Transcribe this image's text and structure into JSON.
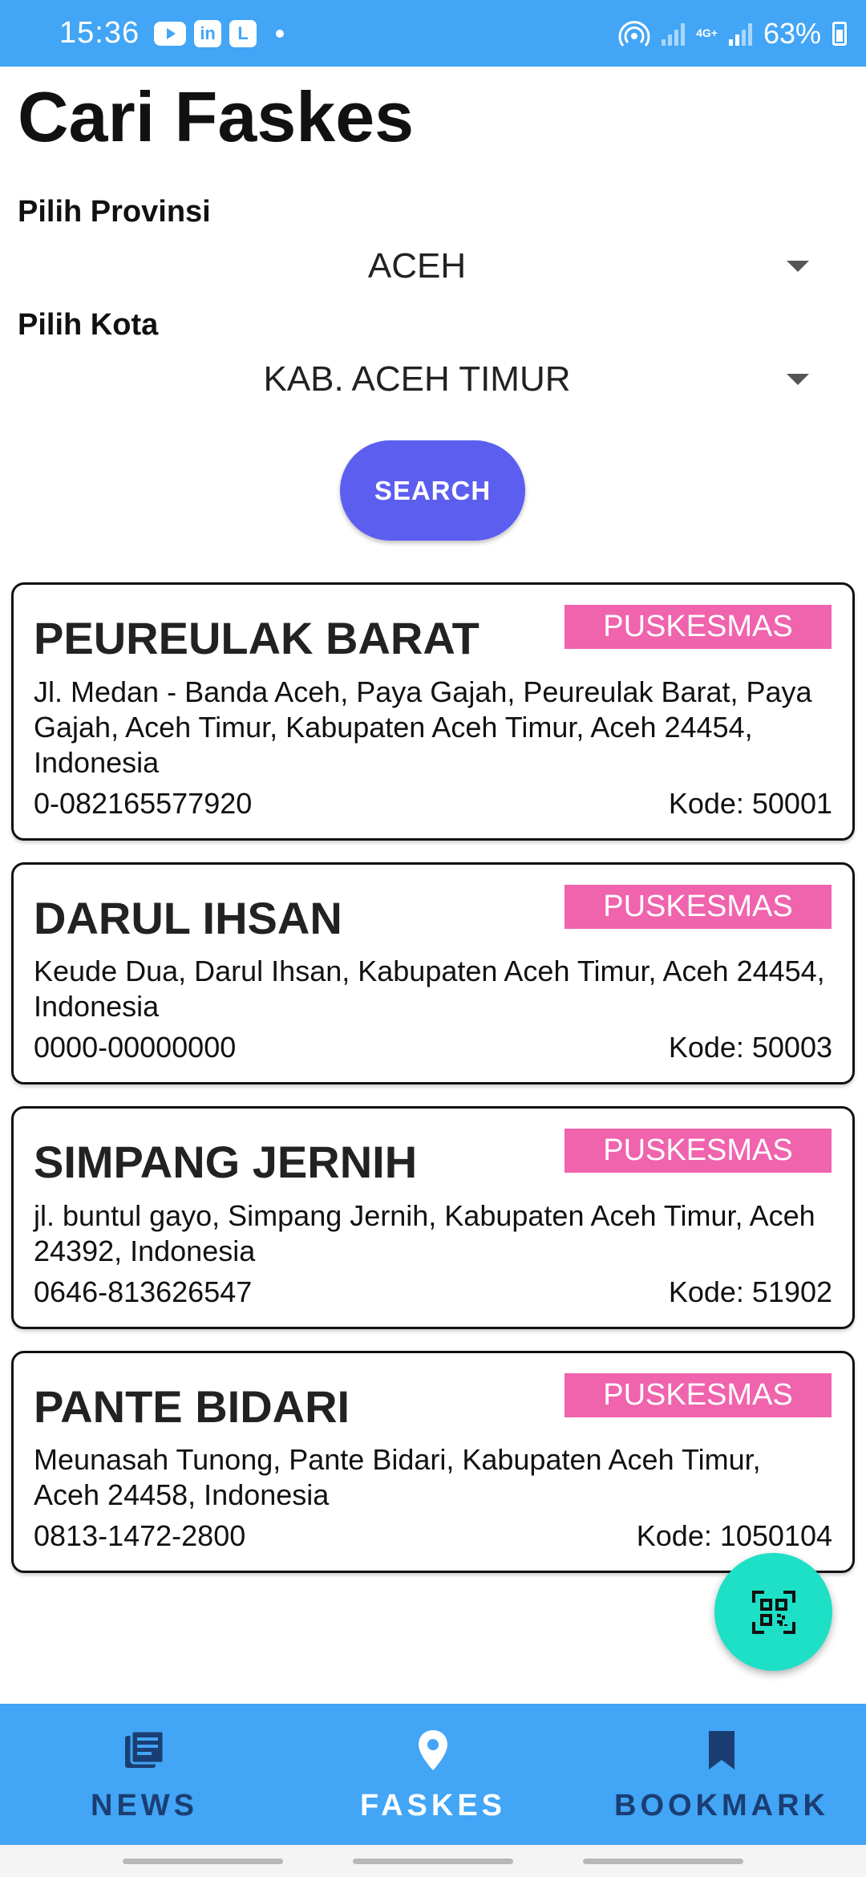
{
  "status_bar": {
    "time": "15:36",
    "network": "4G+",
    "battery": "63%",
    "app_icons": [
      "youtube-icon",
      "linkedin-icon",
      "l-app-icon"
    ]
  },
  "page": {
    "title": "Cari Faskes"
  },
  "filters": {
    "province_label": "Pilih Provinsi",
    "province_value": "ACEH",
    "city_label": "Pilih Kota",
    "city_value": "KAB. ACEH TIMUR",
    "search_label": "SEARCH"
  },
  "facilities": [
    {
      "name": "PEUREULAK BARAT",
      "type": "PUSKESMAS",
      "address": "Jl. Medan - Banda Aceh, Paya Gajah, Peureulak Barat, Paya Gajah, Aceh Timur, Kabupaten Aceh Timur, Aceh 24454, Indonesia",
      "phone": "0-082165577920",
      "code": "Kode: 50001"
    },
    {
      "name": "DARUL IHSAN",
      "type": "PUSKESMAS",
      "address": "Keude Dua, Darul Ihsan, Kabupaten Aceh Timur, Aceh 24454, Indonesia",
      "phone": "0000-00000000",
      "code": "Kode: 50003"
    },
    {
      "name": "SIMPANG JERNIH",
      "type": "PUSKESMAS",
      "address": "jl. buntul gayo, Simpang Jernih, Kabupaten Aceh Timur, Aceh 24392, Indonesia",
      "phone": "0646-813626547",
      "code": "Kode: 51902"
    },
    {
      "name": "PANTE BIDARI",
      "type": "PUSKESMAS",
      "address": "Meunasah Tunong, Pante Bidari, Kabupaten Aceh Timur, Aceh 24458, Indonesia",
      "phone": "0813-1472-2800",
      "code": "Kode: 1050104"
    }
  ],
  "fab": {
    "icon": "qr-scan-icon"
  },
  "bottom_nav": {
    "active": "faskes",
    "items": [
      {
        "label": "NEWS",
        "icon": "news-icon"
      },
      {
        "label": "FASKES",
        "icon": "location-pin-icon"
      },
      {
        "label": "BOOKMARK",
        "icon": "bookmark-icon"
      }
    ]
  },
  "colors": {
    "primary": "#42a5f5",
    "button": "#5c5ef0",
    "badge": "#f063ad",
    "fab": "#1de0c6",
    "nav_inactive": "#1a3e73"
  }
}
